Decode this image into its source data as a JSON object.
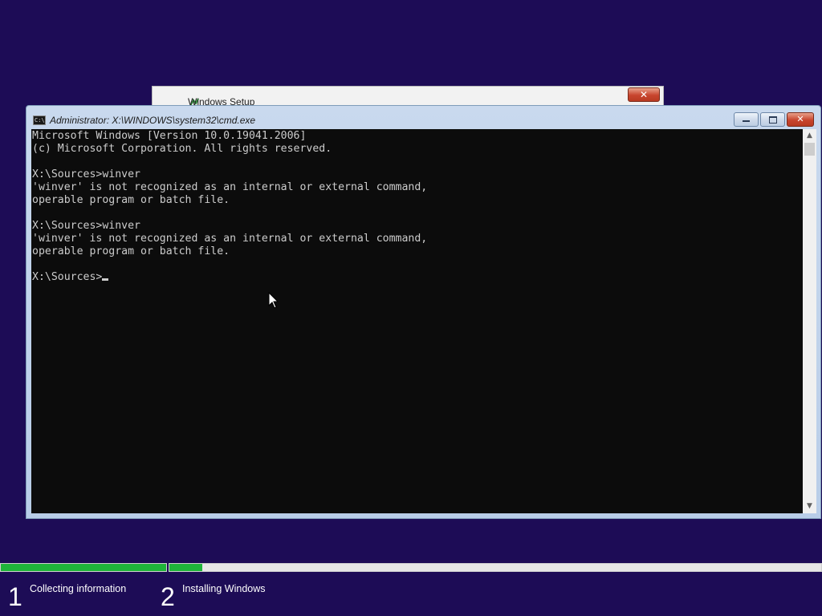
{
  "background_window": {
    "title": "Windows Setup",
    "close_label": "✕"
  },
  "cmd_window": {
    "title": "Administrator: X:\\WINDOWS\\system32\\cmd.exe",
    "icon_label": "C:\\",
    "minimize_label": "",
    "maximize_label": "",
    "close_label": "✕",
    "console_lines": [
      "Microsoft Windows [Version 10.0.19041.2006]",
      "(c) Microsoft Corporation. All rights reserved.",
      "",
      "X:\\Sources>winver",
      "'winver' is not recognized as an internal or external command,",
      "operable program or batch file.",
      "",
      "X:\\Sources>winver",
      "'winver' is not recognized as an internal or external command,",
      "operable program or batch file.",
      ""
    ],
    "prompt": "X:\\Sources>"
  },
  "progress": {
    "step1_fraction": 1.0,
    "step2_fraction": 0.05,
    "accent_color": "#1fb43a"
  },
  "steps": [
    {
      "number": "1",
      "label": "Collecting information"
    },
    {
      "number": "2",
      "label": "Installing Windows"
    }
  ],
  "icons": {
    "setup_icon": "windows-setup-icon",
    "cmd_icon": "console-icon",
    "pointer": "arrow-pointer-icon"
  }
}
